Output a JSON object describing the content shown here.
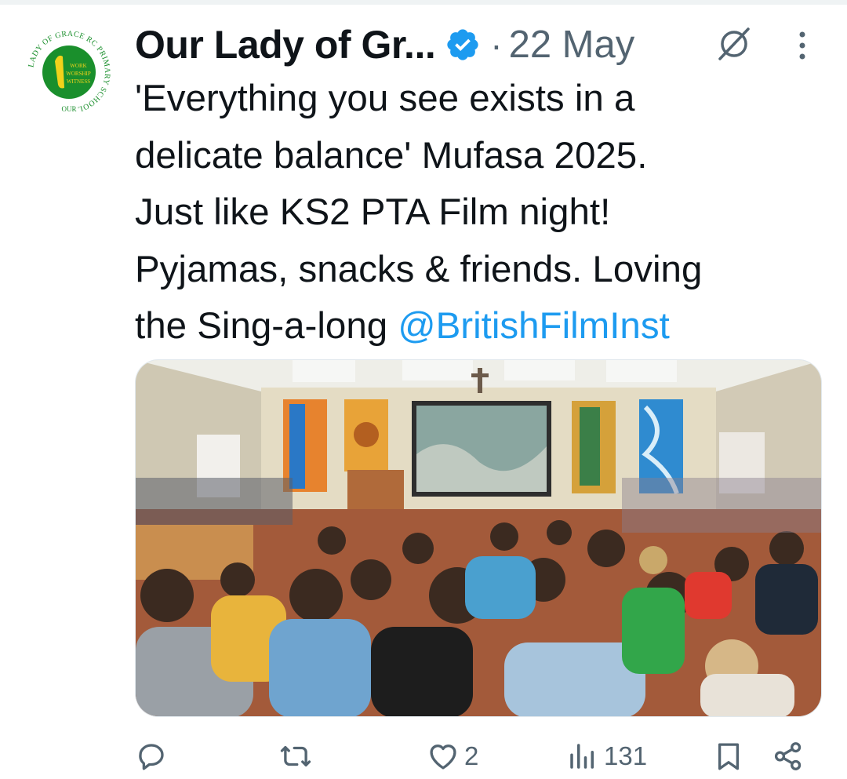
{
  "tweet": {
    "display_name": "Our Lady of Gr...",
    "separator": "·",
    "timestamp": "22 May",
    "text_line1": "'Everything you see exists in a",
    "text_line2": "delicate balance' Mufasa 2025.",
    "text_line3": "Just like KS2 PTA Film night!",
    "text_line4": "Pyjamas, snacks & friends. Loving",
    "text_line5_prefix": "the Sing-a-long ",
    "mention": "@BritishFilmInst"
  },
  "avatar_logo": {
    "ring_text_top": "LADY OF GRACE RC PRIMARY SCHOOL",
    "ring_text_bottom": "OUR",
    "motto_1": "WORK",
    "motto_2": "WORSHIP",
    "motto_3": "WITNESS",
    "color_green": "#1a8f2c",
    "color_yellow": "#f2d21b"
  },
  "actions": {
    "reply_count": "",
    "retweet_count": "",
    "like_count": "2",
    "views_count": "131"
  },
  "icons": [
    "verified-badge-icon",
    "grok-icon",
    "more-icon",
    "reply-icon",
    "retweet-icon",
    "like-icon",
    "views-icon",
    "bookmark-icon",
    "share-icon"
  ],
  "colors": {
    "accent": "#1d9bf0",
    "muted": "#536471",
    "text": "#0f1419"
  }
}
